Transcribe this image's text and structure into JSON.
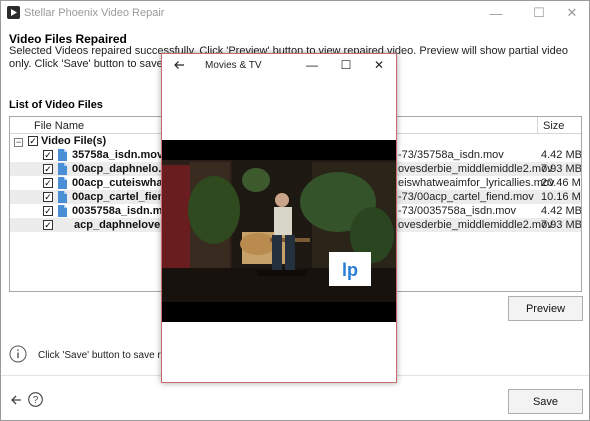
{
  "window": {
    "title": "Stellar Phoenix Video Repair",
    "controls": {
      "minimize": "—",
      "maximize": "☐",
      "close": "✕"
    }
  },
  "header": {
    "title": "Video Files Repaired",
    "description": "Selected Videos repaired successfully. Click 'Preview' button to view repaired video. Preview will show partial video only. Click 'Save' button to save repaired videos at sel"
  },
  "list": {
    "section_label": "List of Video Files",
    "columns": {
      "file_name": "File Name",
      "size": "Size"
    },
    "root": {
      "label": "Video File(s)",
      "toggle": "−",
      "checked": "✓"
    },
    "rows": [
      {
        "name": "35758a_isdn.mov",
        "path": "-73/35758a_isdn.mov",
        "size": "4.42 MB",
        "checked": "✓"
      },
      {
        "name": "00acp_daphnelo...",
        "path": "ovesderbie_middlemiddle2.mov",
        "size": "7.93 MB",
        "checked": "✓"
      },
      {
        "name": "00acp_cuteiswhat...",
        "path": "eiswhatweaimfor_lyricallies.mov",
        "size": "20.46 MB",
        "checked": "✓"
      },
      {
        "name": "00acp_cartel_fiend...",
        "path": "-73/00acp_cartel_fiend.mov",
        "size": "10.16 MB",
        "checked": "✓"
      },
      {
        "name": "0035758a_isdn.mov",
        "path": "-73/0035758a_isdn.mov",
        "size": "4.42 MB",
        "checked": "✓"
      },
      {
        "name": "acp_daphnelove...",
        "path": "ovesderbie_middlemiddle2.mov",
        "size": "7.93 MB",
        "checked": "✓"
      }
    ]
  },
  "preview_button": "Preview",
  "info": {
    "icon": "info-icon",
    "text": "Click 'Save' button to save repa"
  },
  "footer": {
    "save_button": "Save",
    "back_icon": "back-arrow-icon",
    "help_icon": "help-icon",
    "help_glyph": "?"
  },
  "movies_window": {
    "title": "Movies & TV",
    "controls": {
      "minimize": "—",
      "maximize": "☐",
      "close": "✕"
    },
    "watermark_text": "lp"
  },
  "colors": {
    "accent_border": "#c86b6b",
    "row_alt": "#ececec",
    "file_icon": "#4a8fd6"
  }
}
